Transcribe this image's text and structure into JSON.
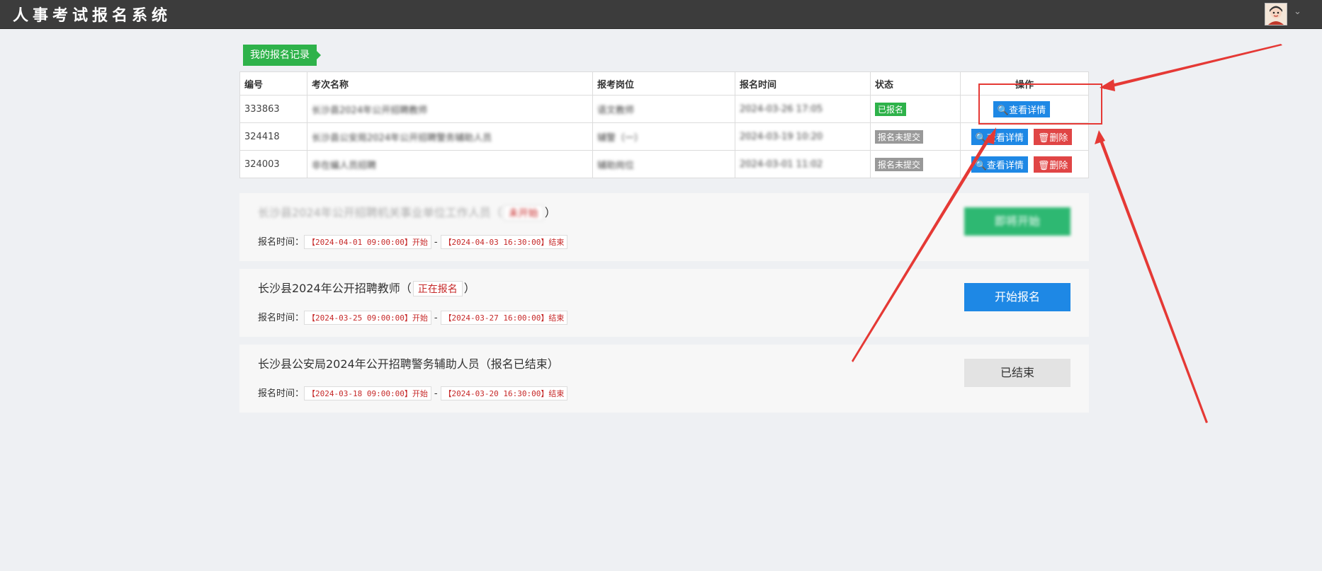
{
  "app": {
    "title": "人事考试报名系统"
  },
  "section": {
    "title": "我的报名记录"
  },
  "table": {
    "headers": [
      "编号",
      "考次名称",
      "报考岗位",
      "报名时间",
      "状态",
      "操作"
    ],
    "rows": [
      {
        "id": "333863",
        "name": "长沙县2024年公开招聘教师",
        "position": "语文教师",
        "time": "2024-03-26 17:05",
        "status": "已报名",
        "actions": [
          "查看详情"
        ]
      },
      {
        "id": "324418",
        "name": "长沙县公安局2024年公开招聘警务辅助人员",
        "position": "辅警（一）",
        "time": "2024-03-19 10:20",
        "status": "报名未提交",
        "actions": [
          "查看详情",
          "删除"
        ]
      },
      {
        "id": "324003",
        "name": "非在编人员招聘",
        "position": "辅助岗位",
        "time": "2024-03-01 11:02",
        "status": "报名未提交",
        "actions": [
          "查看详情",
          "删除"
        ]
      }
    ]
  },
  "cards": [
    {
      "title_prefix": "长沙县2024年公开招聘机关事业单位工作人员（",
      "status_badge": "未开始",
      "title_suffix": "）",
      "time_label": "报名时间：",
      "start": "【2024-04-01 09:00:00】开始",
      "end": "【2024-04-03 16:30:00】结束",
      "button": "即将开始"
    },
    {
      "title_prefix": "长沙县2024年公开招聘教师（",
      "status_badge": "正在报名",
      "title_suffix": "）",
      "time_label": "报名时间：",
      "start": "【2024-03-25 09:00:00】开始",
      "end": "【2024-03-27 16:00:00】结束",
      "button": "开始报名"
    },
    {
      "title_prefix": "长沙县公安局2024年公开招聘警务辅助人员（",
      "status_badge": "报名已结束",
      "title_suffix": "）",
      "time_label": "报名时间：",
      "start": "【2024-03-18 09:00:00】开始",
      "end": "【2024-03-20 16:30:00】结束",
      "button": "已结束"
    }
  ],
  "colors": {
    "topbar": "#3c3c3c",
    "green": "#2eb24a",
    "blue": "#1e88e5",
    "red": "#e04545",
    "annotation": "#e53935"
  },
  "icons": {
    "view": "search-icon",
    "delete": "trash-icon",
    "user": "avatar",
    "menu": "chevron-down-icon"
  }
}
